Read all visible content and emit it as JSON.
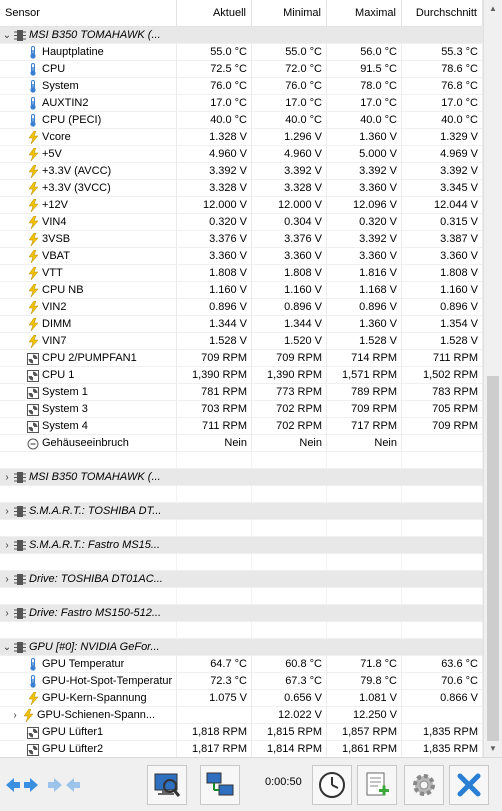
{
  "columns": [
    "Sensor",
    "Aktuell",
    "Minimal",
    "Maximal",
    "Durchschnitt"
  ],
  "rows": [
    {
      "type": "group",
      "expanded": true,
      "icon": "chip-icon",
      "name": "MSI B350 TOMAHAWK (...",
      "a": "",
      "b": "",
      "c": "",
      "d": ""
    },
    {
      "type": "item",
      "icon": "thermometer-icon",
      "name": "Hauptplatine",
      "a": "55.0 °C",
      "b": "55.0 °C",
      "c": "56.0 °C",
      "d": "55.3 °C"
    },
    {
      "type": "item",
      "icon": "thermometer-icon",
      "name": "CPU",
      "a": "72.5 °C",
      "b": "72.0 °C",
      "c": "91.5 °C",
      "d": "78.6 °C"
    },
    {
      "type": "item",
      "icon": "thermometer-icon",
      "name": "System",
      "a": "76.0 °C",
      "b": "76.0 °C",
      "c": "78.0 °C",
      "d": "76.8 °C"
    },
    {
      "type": "item",
      "icon": "thermometer-icon",
      "name": "AUXTIN2",
      "a": "17.0 °C",
      "b": "17.0 °C",
      "c": "17.0 °C",
      "d": "17.0 °C"
    },
    {
      "type": "item",
      "icon": "thermometer-icon",
      "name": "CPU (PECI)",
      "a": "40.0 °C",
      "b": "40.0 °C",
      "c": "40.0 °C",
      "d": "40.0 °C"
    },
    {
      "type": "item",
      "icon": "bolt-icon",
      "name": "Vcore",
      "a": "1.328 V",
      "b": "1.296 V",
      "c": "1.360 V",
      "d": "1.329 V"
    },
    {
      "type": "item",
      "icon": "bolt-icon",
      "name": "+5V",
      "a": "4.960 V",
      "b": "4.960 V",
      "c": "5.000 V",
      "d": "4.969 V"
    },
    {
      "type": "item",
      "icon": "bolt-icon",
      "name": "+3.3V (AVCC)",
      "a": "3.392 V",
      "b": "3.392 V",
      "c": "3.392 V",
      "d": "3.392 V"
    },
    {
      "type": "item",
      "icon": "bolt-icon",
      "name": "+3.3V (3VCC)",
      "a": "3.328 V",
      "b": "3.328 V",
      "c": "3.360 V",
      "d": "3.345 V"
    },
    {
      "type": "item",
      "icon": "bolt-icon",
      "name": "+12V",
      "a": "12.000 V",
      "b": "12.000 V",
      "c": "12.096 V",
      "d": "12.044 V"
    },
    {
      "type": "item",
      "icon": "bolt-icon",
      "name": "VIN4",
      "a": "0.320 V",
      "b": "0.304 V",
      "c": "0.320 V",
      "d": "0.315 V"
    },
    {
      "type": "item",
      "icon": "bolt-icon",
      "name": "3VSB",
      "a": "3.376 V",
      "b": "3.376 V",
      "c": "3.392 V",
      "d": "3.387 V"
    },
    {
      "type": "item",
      "icon": "bolt-icon",
      "name": "VBAT",
      "a": "3.360 V",
      "b": "3.360 V",
      "c": "3.360 V",
      "d": "3.360 V"
    },
    {
      "type": "item",
      "icon": "bolt-icon",
      "name": "VTT",
      "a": "1.808 V",
      "b": "1.808 V",
      "c": "1.816 V",
      "d": "1.808 V"
    },
    {
      "type": "item",
      "icon": "bolt-icon",
      "name": "CPU NB",
      "a": "1.160 V",
      "b": "1.160 V",
      "c": "1.168 V",
      "d": "1.160 V"
    },
    {
      "type": "item",
      "icon": "bolt-icon",
      "name": "VIN2",
      "a": "0.896 V",
      "b": "0.896 V",
      "c": "0.896 V",
      "d": "0.896 V"
    },
    {
      "type": "item",
      "icon": "bolt-icon",
      "name": "DIMM",
      "a": "1.344 V",
      "b": "1.344 V",
      "c": "1.360 V",
      "d": "1.354 V"
    },
    {
      "type": "item",
      "icon": "bolt-icon",
      "name": "VIN7",
      "a": "1.528 V",
      "b": "1.520 V",
      "c": "1.528 V",
      "d": "1.528 V"
    },
    {
      "type": "item",
      "icon": "fan-icon",
      "name": "CPU 2/PUMPFAN1",
      "a": "709 RPM",
      "b": "709 RPM",
      "c": "714 RPM",
      "d": "711 RPM"
    },
    {
      "type": "item",
      "icon": "fan-icon",
      "name": "CPU 1",
      "a": "1,390 RPM",
      "b": "1,390 RPM",
      "c": "1,571 RPM",
      "d": "1,502 RPM"
    },
    {
      "type": "item",
      "icon": "fan-icon",
      "name": "System 1",
      "a": "781 RPM",
      "b": "773 RPM",
      "c": "789 RPM",
      "d": "783 RPM"
    },
    {
      "type": "item",
      "icon": "fan-icon",
      "name": "System 3",
      "a": "703 RPM",
      "b": "702 RPM",
      "c": "709 RPM",
      "d": "705 RPM"
    },
    {
      "type": "item",
      "icon": "fan-icon",
      "name": "System 4",
      "a": "711 RPM",
      "b": "702 RPM",
      "c": "717 RPM",
      "d": "709 RPM"
    },
    {
      "type": "item",
      "icon": "clock-icon",
      "name": "Gehäuseeinbruch",
      "a": "Nein",
      "b": "Nein",
      "c": "Nein",
      "d": ""
    },
    {
      "type": "blank"
    },
    {
      "type": "group",
      "expanded": false,
      "icon": "chip-icon",
      "name": "MSI B350 TOMAHAWK (...",
      "a": "",
      "b": "",
      "c": "",
      "d": ""
    },
    {
      "type": "blank"
    },
    {
      "type": "group",
      "expanded": false,
      "icon": "chip-icon",
      "name": "S.M.A.R.T.: TOSHIBA DT...",
      "a": "",
      "b": "",
      "c": "",
      "d": ""
    },
    {
      "type": "blank"
    },
    {
      "type": "group",
      "expanded": false,
      "icon": "chip-icon",
      "name": "S.M.A.R.T.: Fastro MS15...",
      "a": "",
      "b": "",
      "c": "",
      "d": ""
    },
    {
      "type": "blank"
    },
    {
      "type": "group",
      "expanded": false,
      "icon": "chip-icon",
      "name": "Drive: TOSHIBA DT01AC...",
      "a": "",
      "b": "",
      "c": "",
      "d": ""
    },
    {
      "type": "blank"
    },
    {
      "type": "group",
      "expanded": false,
      "icon": "chip-icon",
      "name": "Drive: Fastro MS150-512...",
      "a": "",
      "b": "",
      "c": "",
      "d": ""
    },
    {
      "type": "blank"
    },
    {
      "type": "group",
      "expanded": true,
      "icon": "chip-icon",
      "name": "GPU [#0]: NVIDIA GeFor...",
      "a": "",
      "b": "",
      "c": "",
      "d": ""
    },
    {
      "type": "item",
      "icon": "thermometer-icon",
      "name": "GPU Temperatur",
      "a": "64.7 °C",
      "b": "60.8 °C",
      "c": "71.8 °C",
      "d": "63.6 °C"
    },
    {
      "type": "item",
      "icon": "thermometer-icon",
      "name": "GPU-Hot-Spot-Temperatur",
      "a": "72.3 °C",
      "b": "67.3 °C",
      "c": "79.8 °C",
      "d": "70.6 °C"
    },
    {
      "type": "item",
      "icon": "bolt-icon",
      "name": "GPU-Kern-Spannung",
      "a": "1.075 V",
      "b": "0.656 V",
      "c": "1.081 V",
      "d": "0.866 V"
    },
    {
      "type": "subgroup",
      "icon": "bolt-icon",
      "name": "GPU-Schienen-Spann...",
      "a": "",
      "b": "12.022 V",
      "c": "12.250 V",
      "d": ""
    },
    {
      "type": "item",
      "icon": "fan-icon",
      "name": "GPU Lüfter1",
      "a": "1,818 RPM",
      "b": "1,815 RPM",
      "c": "1,857 RPM",
      "d": "1,835 RPM"
    },
    {
      "type": "item",
      "icon": "fan-icon",
      "name": "GPU Lüfter2",
      "a": "1,817 RPM",
      "b": "1,814 RPM",
      "c": "1,861 RPM",
      "d": "1,835 RPM"
    }
  ],
  "toolbar": {
    "timer": "0:00:50",
    "buttons": [
      "nav-expand-icon",
      "nav-collapse-icon",
      "monitor-search-icon",
      "network-icon",
      "clock-icon",
      "add-report-icon",
      "settings-icon",
      "close-icon"
    ]
  },
  "colors": {
    "thermometer": "#3b7fd0",
    "bolt": "#f2c200",
    "fan": "#555555",
    "close": "#2a7fd4",
    "nav": "#3a8fe0"
  }
}
